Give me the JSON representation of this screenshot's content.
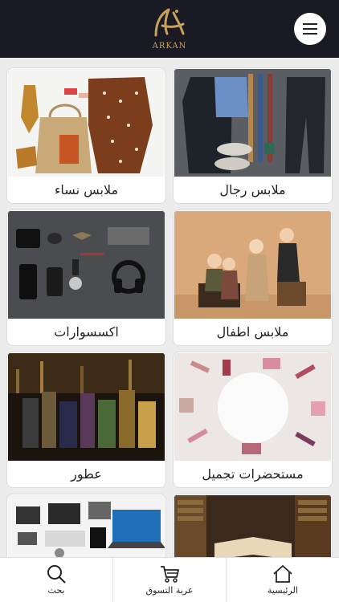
{
  "header": {
    "logo_text": "ARKAN",
    "menu_icon": "hamburger-icon"
  },
  "categories": [
    {
      "label": "ملابس رجال"
    },
    {
      "label": "ملابس نساء"
    },
    {
      "label": "ملابس اطفال"
    },
    {
      "label": "اكسسوارات"
    },
    {
      "label": "مستحضرات تجميل"
    },
    {
      "label": "عطور"
    },
    {
      "label": ""
    },
    {
      "label": ""
    }
  ],
  "bottom_nav": {
    "home": {
      "label": "الرئيسية",
      "icon": "home-icon"
    },
    "cart": {
      "label": "عربة التسوق",
      "icon": "cart-icon"
    },
    "search": {
      "label": "بحث",
      "icon": "search-icon"
    }
  },
  "colors": {
    "header_bg": "#1a1a24",
    "logo_gold": "#c9a25a",
    "page_bg": "#ececec"
  }
}
